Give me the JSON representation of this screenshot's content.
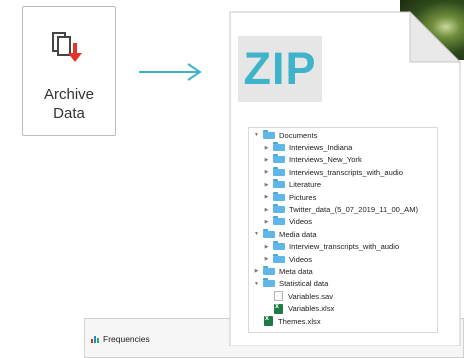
{
  "archive": {
    "label_line1": "Archive",
    "label_line2": "Data",
    "icon": "archive-down-arrow-icon"
  },
  "arrow": {
    "icon": "right-arrow-icon",
    "color": "#3fb3c9"
  },
  "zip": {
    "label": "ZIP",
    "color": "#3fb3c9"
  },
  "tree": [
    {
      "label": "Documents",
      "type": "folder",
      "level": 0,
      "expanded": true
    },
    {
      "label": "Interviews_Indiana",
      "type": "folder",
      "level": 1,
      "expanded": false
    },
    {
      "label": "Interviews_New_York",
      "type": "folder",
      "level": 1,
      "expanded": false
    },
    {
      "label": "Interviews_transcripts_with_audio",
      "type": "folder",
      "level": 1,
      "expanded": false
    },
    {
      "label": "Literature",
      "type": "folder",
      "level": 1,
      "expanded": false
    },
    {
      "label": "Pictures",
      "type": "folder",
      "level": 1,
      "expanded": false
    },
    {
      "label": "Twitter_data_(5_07_2019_11_00_AM)",
      "type": "folder",
      "level": 1,
      "expanded": false
    },
    {
      "label": "Videos",
      "type": "folder",
      "level": 1,
      "expanded": false
    },
    {
      "label": "Media data",
      "type": "folder",
      "level": 0,
      "expanded": true
    },
    {
      "label": "Interview_transcripts_with_audio",
      "type": "folder",
      "level": 1,
      "expanded": false
    },
    {
      "label": "Videos",
      "type": "folder",
      "level": 1,
      "expanded": false
    },
    {
      "label": "Meta data",
      "type": "folder",
      "level": 0,
      "expanded": false
    },
    {
      "label": "Statistical data",
      "type": "folder",
      "level": 0,
      "expanded": true
    },
    {
      "label": "Variables.sav",
      "type": "sav",
      "level": 1
    },
    {
      "label": "Variables.xlsx",
      "type": "xlsx",
      "level": 1
    },
    {
      "label": "Themes.xlsx",
      "type": "xlsx",
      "level": 0
    }
  ],
  "background_window": {
    "title": "Frequencies",
    "icon": "frequencies-icon"
  }
}
